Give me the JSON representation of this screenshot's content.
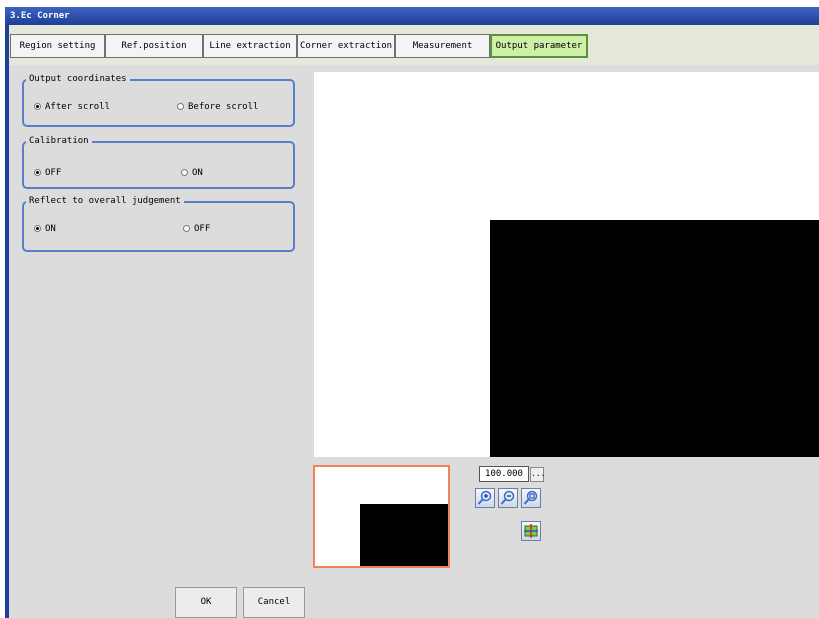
{
  "window": {
    "title": "3.Ec Corner"
  },
  "tabs": [
    {
      "label": "Region setting",
      "active": false
    },
    {
      "label": "Ref.position",
      "active": false
    },
    {
      "label": "Line extraction",
      "active": false
    },
    {
      "label": "Corner extraction",
      "active": false
    },
    {
      "label": "Measurement",
      "active": false
    },
    {
      "label": "Output parameter",
      "active": true
    }
  ],
  "groups": {
    "output_coordinates": {
      "title": "Output coordinates",
      "options": [
        "After scroll",
        "Before scroll"
      ],
      "selected": "After scroll"
    },
    "calibration": {
      "title": "Calibration",
      "options": [
        "OFF",
        "ON"
      ],
      "selected": "OFF"
    },
    "reflect": {
      "title": "Reflect to overall judgement",
      "options": [
        "ON",
        "OFF"
      ],
      "selected": "ON"
    }
  },
  "zoom": {
    "value": "100.000",
    "more_label": "..."
  },
  "icons": [
    "zoom-in-icon",
    "zoom-out-icon",
    "zoom-fit-icon",
    "image-display-icon"
  ],
  "buttons": {
    "ok": "OK",
    "cancel": "Cancel"
  },
  "colors": {
    "title_bar": "#1d3f9a",
    "active_tab": "#cdefa8",
    "group_border": "#5a7ec9",
    "thumbnail_border": "#f0825a"
  }
}
